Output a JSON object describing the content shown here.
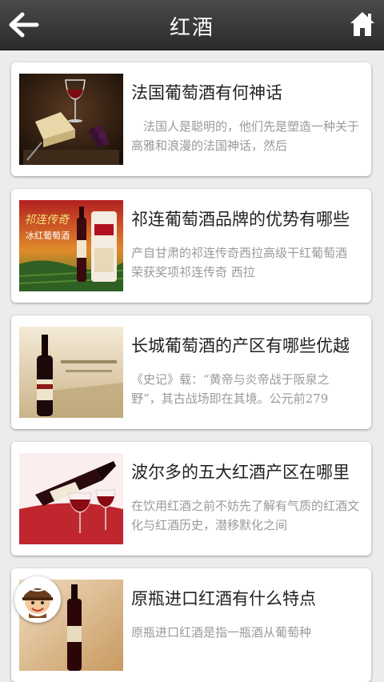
{
  "header": {
    "title": "红酒",
    "back_icon": "arrow-left-icon",
    "home_icon": "home-icon"
  },
  "articles": [
    {
      "title": "法国葡萄酒有何神话",
      "desc": "　法国人是聪明的，他们先是塑造一种关于高雅和浪漫的法国神话，然后"
    },
    {
      "title": "祁连葡萄酒品牌的优势有哪些",
      "desc": "产自甘肃的祁连传奇西拉高级干红葡萄酒 荣获奖项祁连传奇 西拉",
      "image_text": {
        "brand": "祁连传奇",
        "product": "冰红葡萄酒"
      }
    },
    {
      "title": "长城葡萄酒的产区有哪些优越",
      "desc": "《史记》载：“黄帝与炎帝战于阪泉之野”，其古战场即在其境。公元前279"
    },
    {
      "title": "波尔多的五大红酒产区在哪里",
      "desc": "在饮用红酒之前不妨先了解有气质的红酒文化与红酒历史，潜移默化之间"
    },
    {
      "title": "原瓶进口红酒有什么特点",
      "desc": "原瓶进口红酒是指一瓶酒从葡萄种"
    }
  ],
  "colors": {
    "header_bg": "#333333",
    "title_text": "#222222",
    "desc_text": "#9a9a9a"
  }
}
